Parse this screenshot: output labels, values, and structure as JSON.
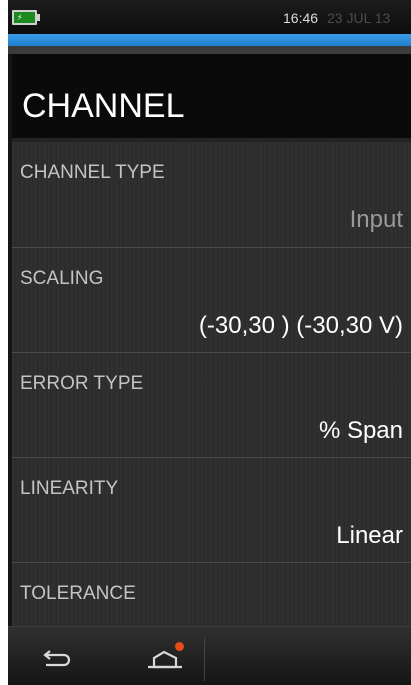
{
  "status_bar": {
    "time": "16:46",
    "date": "23 JUL 13",
    "battery_icon": "battery-charging-icon",
    "battery_color": "#1d8a1d"
  },
  "header": {
    "title": "CHANNEL",
    "accent_color": "#2b8fe0"
  },
  "settings": [
    {
      "label": "CHANNEL TYPE",
      "value": "Input"
    },
    {
      "label": "SCALING",
      "value": "(-30,30 ) (-30,30 V)"
    },
    {
      "label": "ERROR TYPE",
      "value": "% Span"
    },
    {
      "label": "LINEARITY",
      "value": "Linear"
    },
    {
      "label": "TOLERANCE",
      "value": ""
    }
  ],
  "nav_bar": {
    "back_icon": "back-arrow-icon",
    "home_icon": "home-icon",
    "notification_color": "#e84a1c"
  }
}
